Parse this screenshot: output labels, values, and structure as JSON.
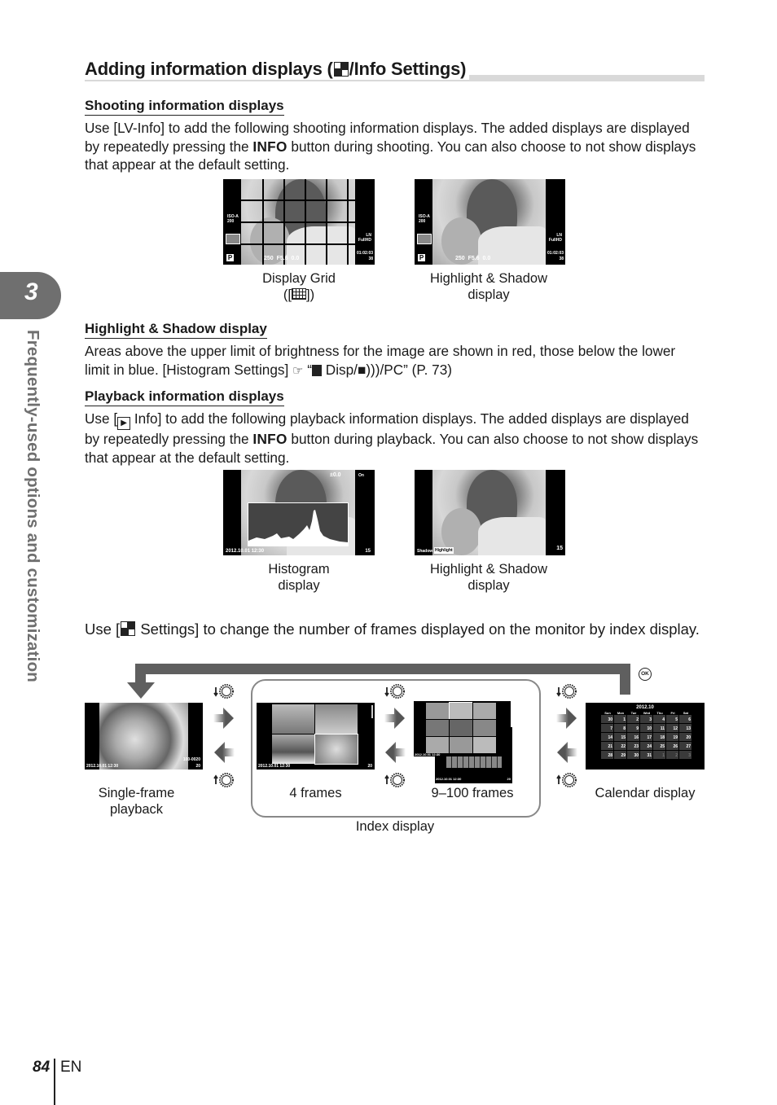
{
  "header": {
    "title_prefix": "Adding information displays (",
    "title_icon": "index-display-icon",
    "title_suffix": "/Info Settings)"
  },
  "chapter": {
    "number": "3",
    "side_title": "Frequently-used options and customization"
  },
  "sections": {
    "shooting": {
      "heading": "Shooting information displays",
      "para_1": "Use [LV-Info] to add the following shooting information displays. The added displays are displayed by repeatedly pressing the ",
      "info_key": "INFO",
      "para_2": " button during shooting. You can also choose to not show displays that appear at the default setting.",
      "figures": [
        {
          "caption_line1": "Display Grid",
          "caption_line2": "([",
          "caption_icon": "grid-icon",
          "caption_line2_end": "])",
          "osd": {
            "iso": "ISO-A",
            "iso_val": "200",
            "mode": "P",
            "shutter": "250",
            "aperture": "F5.6",
            "ev": "0.0",
            "quality": "LN",
            "movie": "FullHD",
            "time": "01:02:03",
            "count": "38"
          }
        },
        {
          "caption_line1": "Highlight & Shadow",
          "caption_line2": "display",
          "osd": {
            "iso": "ISO-A",
            "iso_val": "200",
            "mode": "P",
            "shutter": "250",
            "aperture": "F5.6",
            "ev": "0.0",
            "quality": "LN",
            "movie": "FullHD",
            "time": "01:02:03",
            "count": "38"
          }
        }
      ]
    },
    "highlight": {
      "heading": "Highlight & Shadow display",
      "para_1": "Areas above the upper limit of brightness for the image are shown in red, those below the lower limit in blue. [Histogram Settings] ",
      "ref_icon": "reference-hand-icon",
      "para_2": " “",
      "para_3": " Disp/",
      "para_4": "/PC” (P. 73)"
    },
    "playback": {
      "heading": "Playback information displays",
      "para_1a": "Use [",
      "para_1b": " Info] to add the following playback information displays. The added displays are displayed by repeatedly pressing the ",
      "info_key": "INFO",
      "para_2": " button during playback. You can also choose to not show displays that appear at the default setting.",
      "figures": [
        {
          "caption_line1": "Histogram",
          "caption_line2": "display",
          "osd": {
            "datetime": "2012.10.01 12:30",
            "count": "15",
            "protect": "On",
            "exposure": "±0.0"
          }
        },
        {
          "caption_line1": "Highlight & Shadow",
          "caption_line2": "display",
          "osd": {
            "shadow": "Shadow",
            "highlight": "Highlight",
            "count": "15"
          }
        }
      ]
    },
    "index": {
      "para_a": "Use [",
      "para_b": " Settings] to change the number of frames displayed on the monitor by index display.",
      "ok_label": "OK",
      "single": {
        "caption_line1": "Single-frame",
        "caption_line2": "playback",
        "datetime": "2012.10.01 12:30",
        "file": "100-0020",
        "count": "20"
      },
      "four": {
        "caption": "4 frames",
        "datetime": "2012.10.01 12:30",
        "count": "20"
      },
      "many": {
        "caption": "9–100 frames",
        "datetime": "2012.10.01 12:30",
        "count": "20"
      },
      "index_label": "Index display",
      "calendar": {
        "caption": "Calendar display",
        "month": "2012.10",
        "weekdays": [
          "Sun",
          "Mon",
          "Tue",
          "Wed",
          "Thu",
          "Fri",
          "Sat"
        ],
        "days": [
          "30",
          "1",
          "2",
          "3",
          "4",
          "5",
          "6",
          "7",
          "8",
          "9",
          "10",
          "11",
          "12",
          "13",
          "14",
          "15",
          "16",
          "17",
          "18",
          "19",
          "20",
          "21",
          "22",
          "23",
          "24",
          "25",
          "26",
          "27",
          "28",
          "29",
          "30",
          "31",
          "1",
          "2",
          "3"
        ]
      }
    }
  },
  "footer": {
    "page_number": "84",
    "lang": "EN"
  }
}
